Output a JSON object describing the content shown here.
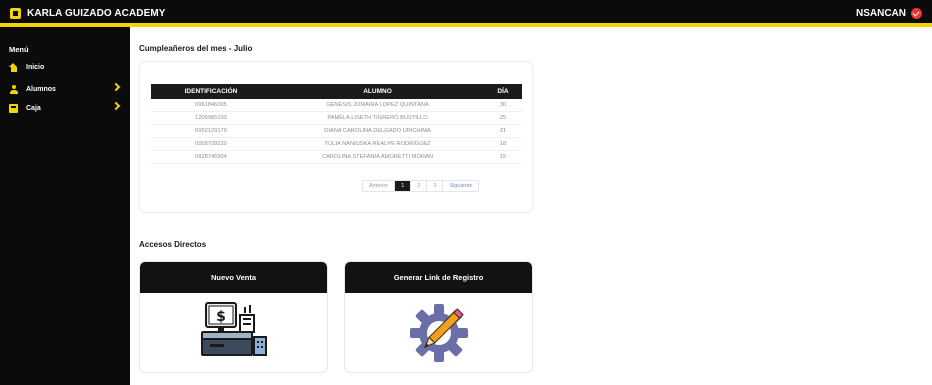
{
  "header": {
    "brand": "KARLA GUIZADO ACADEMY",
    "user": "NSANCAN",
    "accent": "#f2d500"
  },
  "sidebar": {
    "title": "Menú",
    "items": [
      {
        "label": "Inicio",
        "icon": "home-icon"
      },
      {
        "label": "Alumnos",
        "icon": "user-icon"
      },
      {
        "label": "Caja",
        "icon": "cash-box-icon"
      }
    ]
  },
  "birthdays": {
    "title": "Cumpleañeros del mes - Julio",
    "columns": [
      "IDENTIFICACIÓN",
      "ALUMNO",
      "DÍA"
    ],
    "rows": [
      [
        "0961846095",
        "GENESIS JOMAIRA LOPEZ QUINTANA",
        "30"
      ],
      [
        "1205985193",
        "PAMELA LISETH TIGRERO BUSTILLO",
        "25"
      ],
      [
        "0952129179",
        "DIANA CAROLINA DELGADO URICHIMA",
        "21"
      ],
      [
        "0958729220",
        "YULIA NANIUSKA REALPE RODRÍGUEZ",
        "18"
      ],
      [
        "0928746904",
        "CAROLINA STEFANIA AMORETTI MORÁN",
        "15"
      ]
    ],
    "pagination": {
      "prev": "Anterior",
      "pages": [
        "1",
        "2",
        "3"
      ],
      "current": "1",
      "next": "Siguiente"
    }
  },
  "shortcuts": {
    "title": "Accesos Directos",
    "cards": [
      {
        "label": "Nuevo Venta",
        "icon": "cash-register-icon"
      },
      {
        "label": "Generar Link de Registro",
        "icon": "gear-pencil-icon"
      }
    ]
  }
}
